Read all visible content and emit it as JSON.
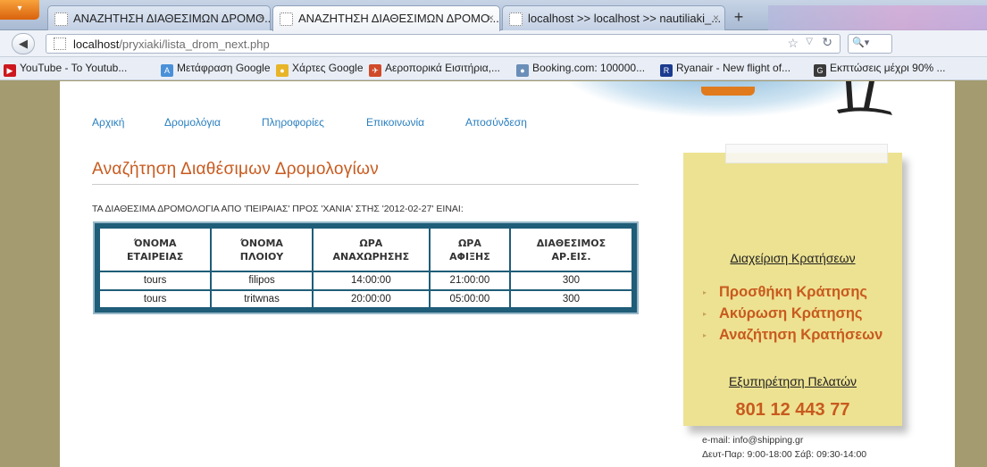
{
  "browser": {
    "tabs": [
      {
        "title": "ΑΝΑΖΗΤΗΣΗ ΔΙΑΘΕΣΙΜΩΝ ΔΡΟΜΟ...",
        "active": false
      },
      {
        "title": "ΑΝΑΖΗΤΗΣΗ ΔΙΑΘΕΣΙΜΩΝ ΔΡΟΜΟ...",
        "active": true
      },
      {
        "title": "localhost >> localhost >> nautiliaki_...",
        "active": false
      }
    ],
    "new_tab_label": "+",
    "url_host": "localhost",
    "url_path": "/pryxiaki/lista_drom_next.php",
    "bookmarks": [
      {
        "label": "YouTube - To Youtub...",
        "icon": "youtube-icon",
        "color": "#cc181e"
      },
      {
        "label": "Μετάφραση Google",
        "icon": "translate-icon",
        "color": "#4a90d9"
      },
      {
        "label": "Χάρτες Google",
        "icon": "maps-icon",
        "color": "#e8b528"
      },
      {
        "label": "Αεροπορικά Εισιτήρια,...",
        "icon": "airline-icon",
        "color": "#d04a2a"
      },
      {
        "label": "Booking.com: 100000...",
        "icon": "booking-icon",
        "color": "#6a8fb8"
      },
      {
        "label": "Ryanair - New flight of...",
        "icon": "ryanair-icon",
        "color": "#1b3b8f"
      },
      {
        "label": "Εκπτώσεις μέχρι 90% ...",
        "icon": "deals-icon",
        "color": "#3a3a3a"
      }
    ]
  },
  "nav": {
    "items": [
      "Αρχική",
      "Δρομολόγια",
      "Πληροφορίες",
      "Επικοινωνία",
      "Αποσύνδεση"
    ]
  },
  "main": {
    "title": "Αναζήτηση Διαθέσιμων Δρομολογίων",
    "subtitle": "ΤΑ ΔΙΑΘΕΣΙΜΑ ΔΡΟΜΟΛΟΓΙΑ ΑΠΟ 'ΠΕΙΡΑΙΑΣ' ΠΡΟΣ 'ΧΑΝΙΑ' ΣΤΗΣ '2012-02-27' ΕΙΝΑΙ:",
    "table": {
      "headers": [
        [
          "ΌΝΟΜΑ",
          "ΕΤΑΙΡΕΙΑΣ"
        ],
        [
          "ΌΝΟΜΑ",
          "ΠΛΟΙΟΥ"
        ],
        [
          "ΩΡΑ",
          "ΑΝΑΧΩΡΗΣΗΣ"
        ],
        [
          "ΩΡΑ",
          "ΑΦΙΞΗΣ"
        ],
        [
          "ΔΙΑΘΕΣΙΜΟΣ",
          "ΑΡ.ΕΙΣ."
        ]
      ],
      "rows": [
        [
          "tours",
          "filipos",
          "14:00:00",
          "21:00:00",
          "300"
        ],
        [
          "tours",
          "tritwnas",
          "20:00:00",
          "05:00:00",
          "300"
        ]
      ]
    }
  },
  "sidebar": {
    "heading": "Διαχείριση Κρατήσεων",
    "links": [
      "Προσθήκη Κράτησης",
      "Ακύρωση Κράτησης",
      "Αναζήτηση Κρατήσεων"
    ],
    "service_heading": "Εξυπηρέτηση Πελατών",
    "phone": "801 12 443 77",
    "email": "e-mail: info@shipping.gr",
    "hours": "Δευτ-Παρ: 9:00-18:00 Σάβ: 09:30-14:00"
  },
  "colors": {
    "accent": "#c85a1e",
    "link": "#2a7fbf",
    "note": "#ede292",
    "table_border": "#1f5d78"
  }
}
